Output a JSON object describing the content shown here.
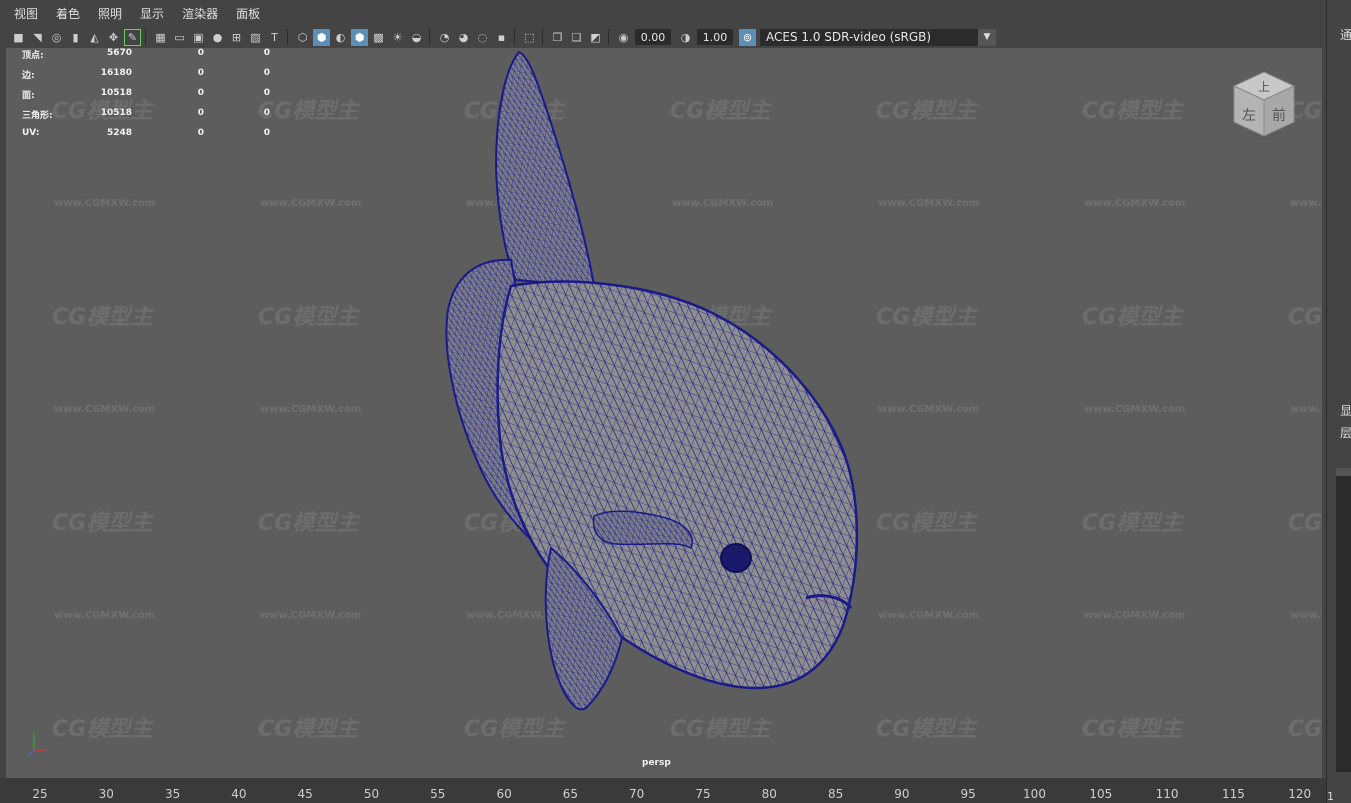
{
  "menu": {
    "items": [
      "视图",
      "着色",
      "照明",
      "显示",
      "渲染器",
      "面板"
    ]
  },
  "toolbar": {
    "exposure_value": "0.00",
    "gamma_value": "1.00",
    "color_space": "ACES 1.0 SDR-video (sRGB)"
  },
  "stats": {
    "rows": [
      {
        "label": "顶点:",
        "v1": "5670",
        "v2": "0",
        "v3": "0"
      },
      {
        "label": "边:",
        "v1": "16180",
        "v2": "0",
        "v3": "0"
      },
      {
        "label": "面:",
        "v1": "10518",
        "v2": "0",
        "v3": "0"
      },
      {
        "label": "三角形:",
        "v1": "10518",
        "v2": "0",
        "v3": "0"
      },
      {
        "label": "UV:",
        "v1": "5248",
        "v2": "0",
        "v3": "0"
      }
    ]
  },
  "viewcube": {
    "top": "上",
    "front": "前",
    "left": "左"
  },
  "camera_label": "persp",
  "watermark": {
    "logo": "CG模型主",
    "url": "www.CGMXW.com"
  },
  "timeline": {
    "ticks": [
      "25",
      "30",
      "35",
      "40",
      "45",
      "50",
      "55",
      "60",
      "65",
      "70",
      "75",
      "80",
      "85",
      "90",
      "95",
      "100",
      "105",
      "110",
      "115",
      "120"
    ]
  },
  "right_panel": {
    "chars": [
      "通",
      "显",
      "层"
    ],
    "number": "1"
  },
  "colors": {
    "viewport_bg": "#5d5d5d",
    "wireframe": "#1a1a8a",
    "highlight": "#5c8fb5"
  }
}
